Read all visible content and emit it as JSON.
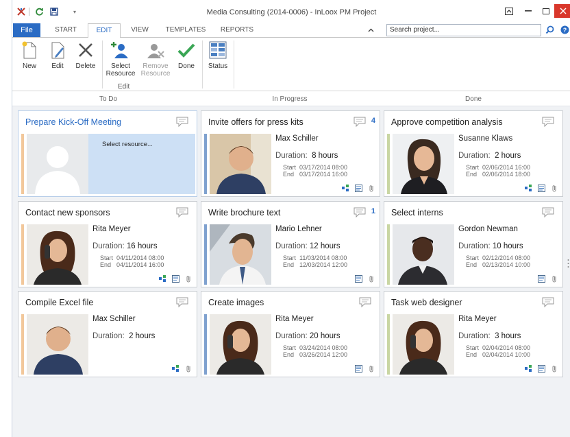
{
  "app": {
    "title": "Media Consulting (2014-0006) - InLoox PM Project"
  },
  "tabs": [
    {
      "label": "File"
    },
    {
      "label": "START"
    },
    {
      "label": "EDIT"
    },
    {
      "label": "VIEW"
    },
    {
      "label": "TEMPLATES"
    },
    {
      "label": "REPORTS"
    }
  ],
  "search": {
    "value": "Search project..."
  },
  "ribbon": {
    "new": "New",
    "edit": "Edit",
    "delete": "Delete",
    "select_resource_1": "Select",
    "select_resource_2": "Resource",
    "remove_resource_1": "Remove",
    "remove_resource_2": "Resource",
    "done": "Done",
    "status": "Status",
    "group_edit": "Edit"
  },
  "columns": [
    "To Do",
    "In Progress",
    "Done"
  ],
  "colors": {
    "accent": "#2b6cc4",
    "stripe_todo": "#f2c89b",
    "stripe_progress": "#7fa1cf",
    "stripe_done": "#c9d6a3",
    "selected_bg": "#cde0f5"
  },
  "cards": [
    {
      "title": "Prepare Kick-Off Meeting",
      "placeholder": "Select resource...",
      "selected": true
    },
    {
      "title": "Invite offers for press kits",
      "comments": "4",
      "name": "Max Schiller",
      "dur_label": "Duration:",
      "dur": "8 hours",
      "start": "03/17/2014 08:00",
      "end": "03/17/2014 16:00",
      "icons": [
        "hierarchy-icon",
        "board-icon",
        "attachment-icon"
      ]
    },
    {
      "title": "Approve competition analysis",
      "name": "Susanne Klaws",
      "dur_label": "Duration:",
      "dur": "2 hours",
      "start": "02/06/2014 16:00",
      "end": "02/06/2014 18:00",
      "icons": [
        "hierarchy-icon",
        "board-icon",
        "attachment-icon"
      ]
    },
    {
      "title": "Contact new sponsors",
      "name": "Rita Meyer",
      "dur_label": "Duration:",
      "dur": "16 hours",
      "start": "04/11/2014 08:00",
      "end": "04/11/2014 16:00",
      "icons": [
        "hierarchy-icon",
        "board-icon",
        "attachment-icon"
      ]
    },
    {
      "title": "Write brochure text",
      "comments": "1",
      "name": "Mario Lehner",
      "dur_label": "Duration:",
      "dur": "12 hours",
      "start": "11/03/2014 08:00",
      "end": "12/03/2014 12:00",
      "icons": [
        "board-icon",
        "attachment-icon"
      ]
    },
    {
      "title": "Select interns",
      "name": "Gordon Newman",
      "dur_label": "Duration:",
      "dur": "10 hours",
      "start": "02/12/2014 08:00",
      "end": "02/13/2014 10:00",
      "icons": [
        "board-icon",
        "attachment-icon"
      ]
    },
    {
      "title": "Compile Excel file",
      "name": "Max Schiller",
      "dur_label": "Duration:",
      "dur": "2 hours",
      "icons": [
        "hierarchy-icon",
        "attachment-icon"
      ]
    },
    {
      "title": "Create images",
      "name": "Rita Meyer",
      "dur_label": "Duration:",
      "dur": "20 hours",
      "start": "03/24/2014 08:00",
      "end": "03/26/2014 12:00",
      "icons": [
        "board-icon",
        "attachment-icon"
      ]
    },
    {
      "title": "Task web designer",
      "name": "Rita Meyer",
      "dur_label": "Duration:",
      "dur": "3 hours",
      "start": "02/04/2014 08:00",
      "end": "02/04/2014 10:00",
      "icons": [
        "hierarchy-icon",
        "board-icon",
        "attachment-icon"
      ]
    }
  ],
  "date_labels": {
    "start": "Start",
    "end": "End"
  }
}
